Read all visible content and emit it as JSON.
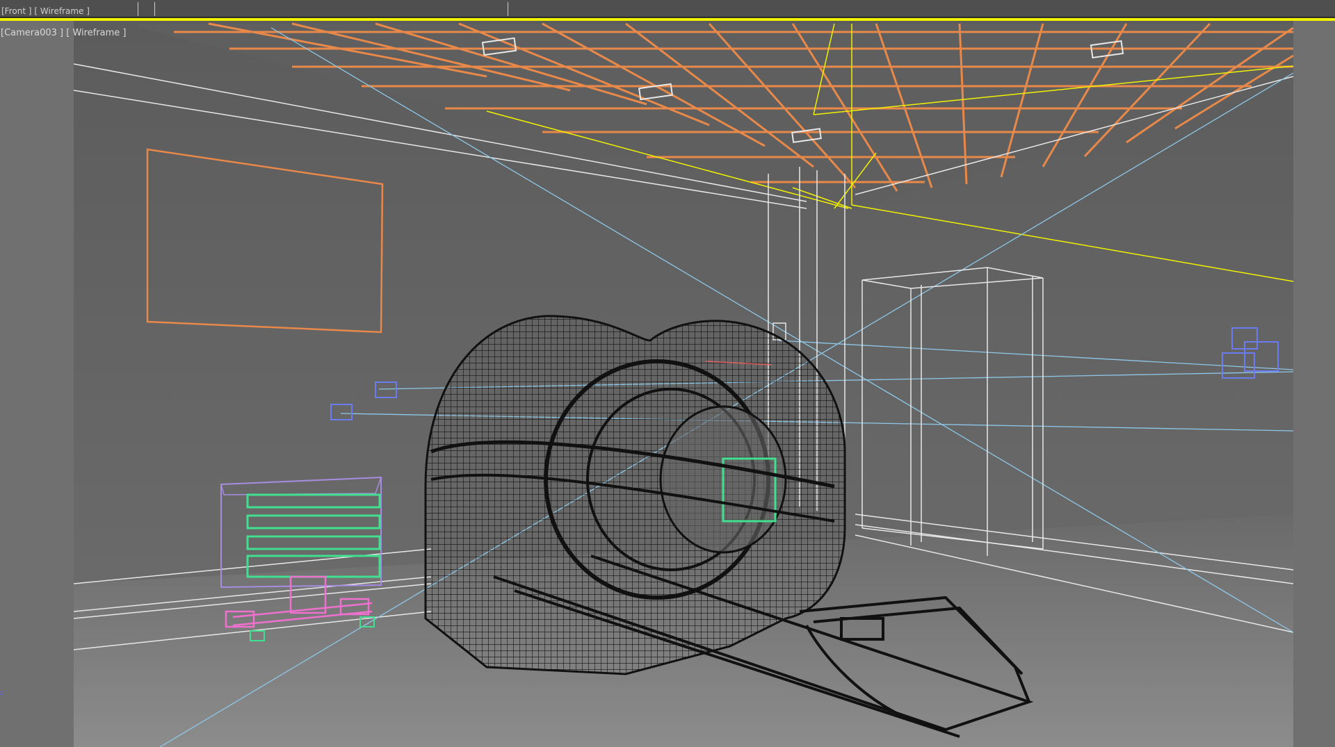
{
  "top_viewport": {
    "label": "[Front ] [ Wireframe ]"
  },
  "main_viewport": {
    "label": "[Camera003 ] [ Wireframe ]",
    "view": "Camera003",
    "shading": "Wireframe",
    "active_border_color": "#f2f200"
  },
  "scene_objects": [
    "wall-panel-frame",
    "ceiling-grid",
    "ceiling-lights",
    "mri-scanner-wireframe",
    "patient-table",
    "storage-cart",
    "doorway-frame",
    "column",
    "cameras",
    "target-lines"
  ],
  "axis_gizmo": {
    "label": "z"
  },
  "colors": {
    "ceiling_grid": "#e8894a",
    "wall_panel": "#e8894a",
    "wireframe_white": "#e8e8e8",
    "camera_lines": "#8ec8e8",
    "scanner": "#111111",
    "cart_body": "#a78de0",
    "cart_drawers": "#40e090",
    "cart_base": "#f070d0",
    "camera_icon": "#6a7cf0"
  }
}
